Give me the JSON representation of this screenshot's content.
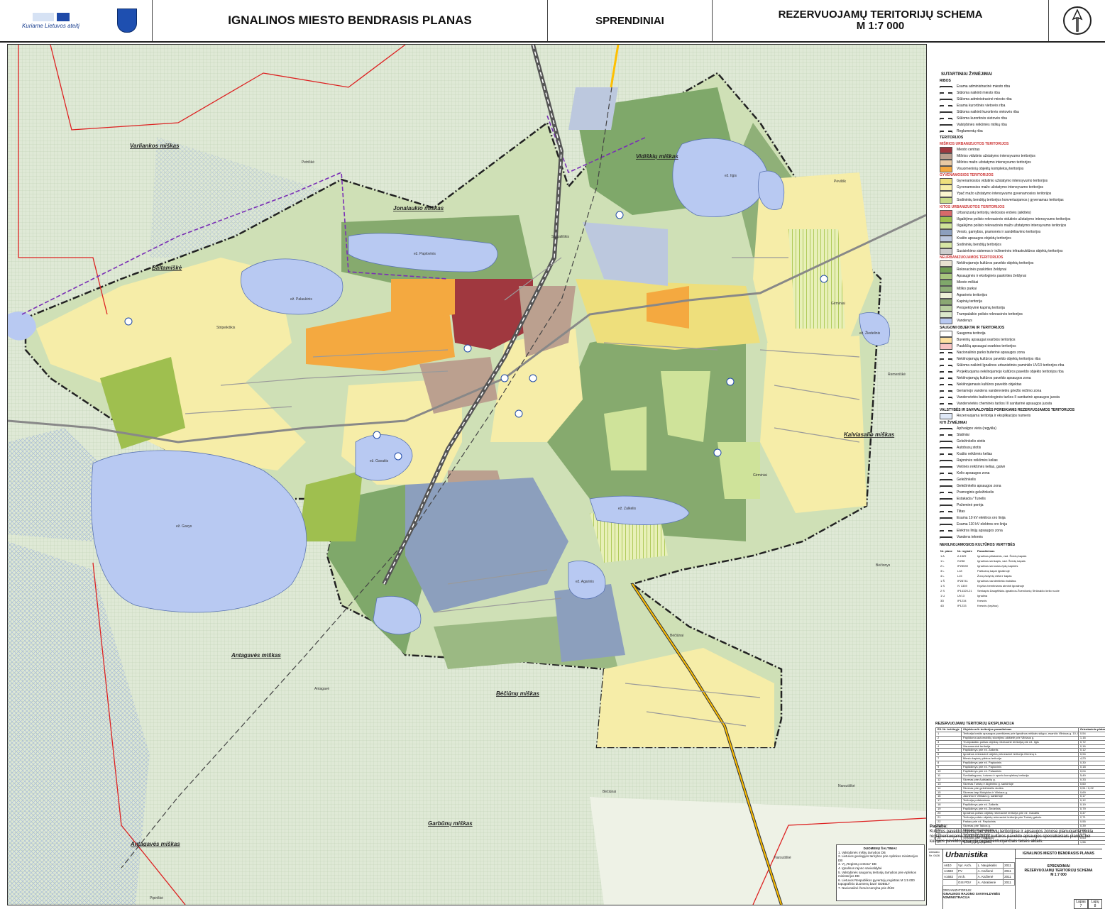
{
  "header": {
    "logo_text": "Kuriame Lietuvos ateitį",
    "title": "IGNALINOS MIESTO BENDRASIS PLANAS",
    "section": "SPRENDINIAI",
    "scheme_title": "REZERVUOJAMŲ TERITORIJŲ SCHEMA",
    "scale": "M  1:7 000"
  },
  "map": {
    "forests": [
      "Varliankos miškas",
      "Jonalaukio miškas",
      "Vidiškių miškas",
      "Baltamiškė",
      "Antagavės miškas",
      "Bėčiūnų miškas",
      "Kalviasalio miškas",
      "Antagavės miškas",
      "Garbūnų miškas"
    ],
    "places": [
      "Petriškė",
      "Strigailiškis",
      "Stripeikiškis",
      "Pėvilišk",
      "Girminiai",
      "Remeniškė",
      "Bėčiūnai",
      "Antagavė",
      "Bėčiūnai",
      "Narsutiškė",
      "Narsutiškė",
      "Pipiriškė",
      "Girminiai",
      "Bėčionys"
    ],
    "lakes": [
      "ež. Paplovinis",
      "ež. Palaukinis",
      "ež. Gavys",
      "ež. Gavaitis",
      "ež. Agarinis",
      "ež. Zalkelis",
      "ež. Ilgis",
      "ež. Žiedelinis"
    ]
  },
  "legend": {
    "title": "SUTARTINIAI ŽYMĖJIMAI",
    "ribos_title": "RIBOS",
    "ribos": [
      "Esama administracinė miesto riba",
      "Siūloma naikinti miesto riba",
      "Siūloma administracinė miesto riba",
      "Esama kurortinės vietovės riba",
      "Siūloma naikinti kurortinės vietovės riba",
      "Siūloma kurortinės vietovės riba",
      "Valstybinės reikšmės miškų riba",
      "Reglamentų riba"
    ],
    "teritorijos_title": "TERITORIJOS",
    "groups": [
      {
        "title": "MIŠRIOS URBANIZUOTOS TERITORIJOS",
        "items": [
          {
            "label": "Miesto centras",
            "color": "#a0383f"
          },
          {
            "label": "Mišrios vidutinio užstatymo intensyvumo teritorijos",
            "color": "#bba08f"
          },
          {
            "label": "Mišrios mažo užstatymo intensyvumo teritorijos",
            "color": "#e8c9a4"
          },
          {
            "label": "Visuomeninių objektų kompleksų teritorijos",
            "color": "#f4a940"
          }
        ]
      },
      {
        "title": "GYVENAMOSIOS TERITORIJOS",
        "items": [
          {
            "label": "Gyvenamosios vidutinio užstatymo intensyvumo teritorijos",
            "color": "#eedf7c"
          },
          {
            "label": "Gyvenamosios mažo užstatymo intensyvumo teritorijos",
            "color": "#f6eda8"
          },
          {
            "label": "Ypač mažo užstatymo intensyvumo gyvenamosios teritorijos",
            "color": "#fbf6cf"
          },
          {
            "label": "Sodininkų bendrijų teritorijos konvertuojamos į gyvenamas teritorijas",
            "color": "#c9dc8a"
          }
        ]
      },
      {
        "title": "KITOS URBANIZUOTOS TERITORIJOS",
        "items": [
          {
            "label": "Urbanizuotų teritorijų viešosios erdvės (aikštės)",
            "color": "#d86a6a"
          },
          {
            "label": "Išgalėjimo poilsio rekreacinės vidutinio užstatymo intensyvumo teritorijos",
            "color": "#9fbf4f"
          },
          {
            "label": "Išgalėjimo poilsio rekreacinės mažo užstatymo intensyvumo teritorijos",
            "color": "#cfe39a"
          },
          {
            "label": "Verslo, gamybos, pramonės ir sandėliavimo teritorijos",
            "color": "#8c9fbd"
          },
          {
            "label": "Krašto apsaugos objektų teritorijos",
            "color": "#bcc8de"
          },
          {
            "label": "Sodininkų bendrijų teritorijos",
            "color": "#d6e6a4"
          },
          {
            "label": "Susisiekimo sistemos ir inžinerinės infrastruktūros objektų teritorijos",
            "color": "#cdcdcd"
          }
        ]
      },
      {
        "title": "NEURBANIZUOJAMOS TERITORIJOS",
        "items": [
          {
            "label": "Nekilnojamojo kultūros paveldo objektų teritorijos",
            "color": "#e7e1d0"
          },
          {
            "label": "Rekreacinės paskirties želdynai",
            "color": "#6f9d52"
          },
          {
            "label": "Apsauginės ir ekologinės paskirties želdynai",
            "color": "#a9c77e"
          },
          {
            "label": "Miesto miškai",
            "color": "#7fa86a"
          },
          {
            "label": "Miško parkai",
            "color": "#8fb078"
          },
          {
            "label": "Agrarinės teritorijos",
            "color": "#eef1d7"
          },
          {
            "label": "Kapinių teritorija",
            "color": "#8aa772"
          },
          {
            "label": "Perspektyvinė kapinių teritorija",
            "color": "#b9cfa0"
          },
          {
            "label": "Trumpalaikio poilsio rekreacinės teritorijos",
            "color": "#dbe8cb"
          },
          {
            "label": "Vandenys",
            "color": "#b8c9f2"
          }
        ]
      }
    ],
    "saugomi_title": "SAUGOMI OBJEKTAI IR TERITORIJOS",
    "saugomi": [
      "Saugoma teritorija",
      "Buveinių apsaugai svarbios teritorijos",
      "Paukščių apsaugai svarbios teritorijos",
      "Nacionalinio parko buferinė apsaugos zona",
      "Nekilnojamųjų kultūros paveldo objektų teritorijos riba",
      "Siūloma naikinti Ignalinos urbanistinės paminklo UV13 teritorijos riba",
      "Projektuojama nekilnojamojo kultūros paveldo objekto teritorijos riba",
      "Nekilnojamųjų kultūros paveldo apsaugos zona",
      "Nekilnojamasis kultūros paveldo objektas",
      "Geriamojo vandens vandenvietės griežto režimo zona",
      "Vandenvietės bakteriologinės taršos II sanitarinė apsaugos juosta",
      "Vandenvietės cheminės taršos III sanitarinė apsaugos juosta"
    ],
    "valstybes_title": "VALSTYBĖS IR SAVIVALDYBĖS POREIKIAMS REZERVUOJAMOS TERITORIJOS",
    "valstybes": [
      "Rezervuojama teritorija ir eksplikacijos numeris"
    ],
    "kiti_title": "KITI ŽYMĖJIMAI",
    "kiti": [
      "Apžvalgos vieta (regykla)",
      "Statiniai",
      "Geležinkelio stotis",
      "Autobusų stotis",
      "Krašto reikšmės kelias",
      "Rajoninės reikšmės kelias",
      "Vietinės reikšmės kelias, gatvė",
      "Kelio apsaugos zona",
      "Geležinkelis",
      "Geležinkelio apsaugos zona",
      "Pramoginis geležinkelis",
      "Estakada / Tunelis",
      "Požeminė perėja",
      "Tiltas",
      "Esama 10 kV elektros oro linija",
      "Esama 110 kV elektros oro linija",
      "Elektros linijų apsaugos zona",
      "Vandens tekmės"
    ],
    "kultura_title": "NEKILNOJAMOSIOS KULTŪROS VERTYBĖS",
    "kultura_head": [
      "Nr. plane",
      "Nr. registre",
      "Pavadinimas"
    ],
    "kultura": [
      [
        "1 A",
        "A 1529",
        "Ignalinos piliakalnis, vad. Švedų kapais"
      ],
      [
        "1 L",
        "IV238",
        "Ignalinos senkapis, vad. Švedų kapais"
      ],
      [
        "2 L",
        "IP25539",
        "Ignalinos senosios žydų kapinės"
      ],
      [
        "3 L",
        "L18",
        "Partizanų kapai Ignalinoje"
      ],
      [
        "4 L",
        "L15",
        "Žuvų žudynių vieta ir kapas"
      ],
      [
        "1 Š",
        "IP28741",
        "Ignalinos vandentiekio bokštas"
      ],
      [
        "1 S",
        "IV 1339",
        "Kryžius tremtiniams atminti Ignalinoje"
      ],
      [
        "2 S",
        "IP14320-21",
        "Senkapis Daugėliškio-Ignalinos-Švenčionių Strūnaičio kelio ruože"
      ],
      [
        "1 U",
        "UV13",
        "Ignalina"
      ],
      [
        "3D",
        "IP1234",
        "Kresnis"
      ],
      [
        "4D",
        "IP1233",
        "Kresnis (kryžius)"
      ]
    ],
    "eksplik_title": "REZERVUOJAMŲ TERITORIJŲ EKSPLIKACIJA",
    "eksplik_head": [
      "Eil. Nr. brėžinyje",
      "Objekto ar/ir teritorijos pavadinimas",
      "Orientacinis plotas, ha"
    ],
    "eksplik": [
      [
        "1",
        "Teritorija krašto apsaugos poreikiams prie Ignalinos miškais sklypo, esančio Vilniaus g. 10, Ignalinoje",
        "0,54"
      ],
      [
        "2",
        "Papildoma automobilių stovėjimo aikštelė prie Vilniaus g.",
        "1,16"
      ],
      [
        "3",
        "Trumpalaikio poilsio objektų rekreacinė teritorija prie ež. Ilgis",
        "0,72"
      ],
      [
        "4",
        "Visuomeninė teritorija",
        "0,16"
      ],
      [
        "5",
        "Paplūdimys prie ež. Zalkelis",
        "0,12"
      ],
      [
        "6",
        "Ignalinos rekreacinė objektų rekreacinė teritorija Girminų k.",
        "0,94"
      ],
      [
        "7",
        "Miesto kapinių plėtros teritorija",
        "4,23"
      ],
      [
        "8",
        "Paplūdimys prie ež. Paplovinis",
        "0,30"
      ],
      [
        "9",
        "Paplūdimys prie ež. Paplovinis",
        "0,18"
      ],
      [
        "10",
        "Paplūdimys prie ež. Palaukinis",
        "0,04"
      ],
      [
        "11",
        "Sveikatingumo, turizmo ir sporto kompleksų teritorija",
        "5,49"
      ],
      [
        "12",
        "Skveras prie Aukštaičių g.",
        "0,33"
      ],
      [
        "13",
        "Skveras Turistų ir Atgimimo g. sankirtoje",
        "0,60"
      ],
      [
        "14",
        "Skveras prie geležinkelio stoties",
        "0,51 / 0,22"
      ],
      [
        "15",
        "Skveras tarp Mokyklos ir Vilniaus g.",
        "0,69"
      ],
      [
        "16",
        "Jaunimo ir Vilniaus g. sankirtoje",
        "0,17"
      ],
      [
        "17",
        "Teritorija poilsiaviams",
        "0,12"
      ],
      [
        "18",
        "Paplūdimys prie ež. Zalkelis",
        "0,19"
      ],
      [
        "19",
        "Paplūdimys prie ež. Žiedelinis",
        "0,79"
      ],
      [
        "20",
        "Ignalinos poilsio objektų rekreacinė teritorija prie ež. Gavaitis",
        "0,47"
      ],
      [
        "21",
        "Teritorija poilsio objektų rekreacinė teritorija prie Turistų gatvės",
        "2,71"
      ],
      [
        "22",
        "Parkas prie ež. Paplovinis",
        "0,55"
      ],
      [
        "23",
        "Skveras prie Taikos g.",
        "0,39"
      ],
      [
        "24",
        "Skveras prie geležinkelio",
        "0,54"
      ],
      [
        "25",
        "Visuomeninė teritorija",
        "0,12"
      ],
      [
        "26",
        "Viešbutis prie Palaukinio",
        "0,53"
      ],
      [
        "27",
        "Turistų prie paplūdimių",
        "1,56"
      ]
    ],
    "note_title": "Pastaba:",
    "note_text": "Kultūros paveldo objektų bei vietovių teritorijose ir apsaugos zonose planuojama veikla reglamentuojama nekilnojamųjų kultūros paveldo apsaugos specialiaisiais planais bei kultūros paveldo apsaugą reglamentuojančiais teisės aktais."
  },
  "sources": {
    "title": "DUOMENŲ ŠALTINIAI:",
    "items": [
      "1. Valstybinės miškų tarnybos DB",
      "2. Lietuvos geologijos tarnybos prie Aplinkos ministerijos DB",
      "3. VĮ „Registrų centras\" DB",
      "4. Ignalinos rajono savivaldybė",
      "5. Valstybinės saugomų teritorijų tarnybos prie Aplinkos ministerijos DB",
      "6. Lietuvos Respublikos gyventojų registras M 1:5 000 topografinio duomenų bazė GDB5LT",
      "7. Nacionalinė žemės tarnyba prie ŽŪM"
    ]
  },
  "titleblock": {
    "atestato": "Atestato Nr. 0426",
    "firm": "Urbanistika",
    "project": "IGNALINOS MIESTO BENDRASIS PLANAS",
    "stage": "SPRENDINIAI",
    "sheet": "REZERVUOJAMŲ TERITORIJŲ SCHEMA",
    "scale": "M  1:7 000",
    "lapas_label": "Lapas",
    "lapu_label": "Lapų",
    "lapas": "7",
    "lapu": "8",
    "persons": [
      [
        "A610",
        "Vyr. Arch.",
        "L. Naujokaitis",
        "2011"
      ],
      [
        "A1682",
        "PV",
        "A. Kažienė",
        "2011"
      ],
      [
        "A1682",
        "Arch.",
        "A. Kažienė",
        "2011"
      ],
      [
        "",
        "GIS PDV",
        "A. Abraitienė",
        "2011"
      ]
    ],
    "organizer_label": "ORGANIZATORIUS:",
    "organizer": "IGNALINOS RAJONO SAVIVALDYBĖS ADMINISTRACIJA"
  }
}
